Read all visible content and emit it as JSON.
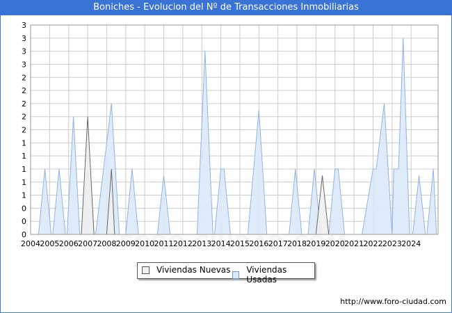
{
  "title": "Boniches - Evolucion del Nº de Transacciones Inmobiliarias",
  "source_url": "http://www.foro-ciudad.com",
  "watermark": "FORO-CIUDAD.COM",
  "colors": {
    "nuevas_fill": "#f0f0f0",
    "nuevas_stroke": "#666666",
    "usadas_fill": "#dce9f8",
    "usadas_stroke": "#8fb4e3",
    "title_bg": "#3a73d6",
    "grid": "#cccccc"
  },
  "chart_data": {
    "type": "area",
    "title": "Boniches - Evolucion del Nº de Transacciones Inmobiliarias",
    "x_ticks": [
      "2004",
      "2005",
      "2006",
      "2007",
      "2008",
      "2009",
      "2010",
      "2011",
      "2012",
      "2013",
      "2014",
      "2015",
      "2016",
      "2017",
      "2018",
      "2019",
      "2020",
      "2021",
      "2022",
      "2023",
      "2024"
    ],
    "y_tick_labels": [
      "0",
      "0",
      "0",
      "1",
      "1",
      "1",
      "1",
      "1",
      "2",
      "2",
      "2",
      "2",
      "2",
      "3",
      "3",
      "3",
      "3"
    ],
    "ylim": [
      0,
      3.2
    ],
    "grid": true,
    "legend_position": "bottom",
    "series": [
      {
        "name": "Viviendas Nuevas",
        "points": [
          [
            "2006-09",
            0
          ],
          [
            "2007-01",
            1.8
          ],
          [
            "2007-05",
            0
          ],
          [
            "2008-01",
            0
          ],
          [
            "2008-04",
            1
          ],
          [
            "2008-06",
            0
          ],
          [
            "2019-01",
            0
          ],
          [
            "2019-05",
            0.9
          ],
          [
            "2019-09",
            0
          ]
        ]
      },
      {
        "name": "Viviendas Usadas",
        "points": [
          [
            "2004-06",
            0
          ],
          [
            "2004-10",
            1
          ],
          [
            "2005-02",
            0
          ],
          [
            "2005-03",
            0
          ],
          [
            "2005-07",
            1
          ],
          [
            "2005-11",
            0
          ],
          [
            "2005-12",
            0
          ],
          [
            "2006-04",
            1.8
          ],
          [
            "2006-08",
            0
          ],
          [
            "2006-09",
            0
          ],
          [
            "2007-01",
            1
          ],
          [
            "2007-05",
            0
          ],
          [
            "2007-06",
            0
          ],
          [
            "2007-11",
            1
          ],
          [
            "2008-04",
            2
          ],
          [
            "2008-09",
            0
          ],
          [
            "2009-01",
            0
          ],
          [
            "2009-05",
            1
          ],
          [
            "2009-09",
            0
          ],
          [
            "2010-09",
            0
          ],
          [
            "2011-01",
            0.9
          ],
          [
            "2011-05",
            0
          ],
          [
            "2012-10",
            0
          ],
          [
            "2013-03",
            2.8
          ],
          [
            "2013-08",
            0
          ],
          [
            "2013-09",
            0
          ],
          [
            "2014-01",
            1
          ],
          [
            "2014-03",
            1
          ],
          [
            "2014-07",
            0
          ],
          [
            "2015-06",
            0
          ],
          [
            "2016-01",
            1.9
          ],
          [
            "2016-06",
            0
          ],
          [
            "2017-08",
            0
          ],
          [
            "2017-12",
            1
          ],
          [
            "2018-04",
            0
          ],
          [
            "2018-08",
            0
          ],
          [
            "2018-12",
            1
          ],
          [
            "2019-04",
            0
          ],
          [
            "2019-09",
            0
          ],
          [
            "2020-01",
            1
          ],
          [
            "2020-03",
            1
          ],
          [
            "2020-07",
            0
          ],
          [
            "2021-06",
            0
          ],
          [
            "2022-01",
            1
          ],
          [
            "2022-03",
            1
          ],
          [
            "2022-08",
            2
          ],
          [
            "2023-01",
            0
          ],
          [
            "2023-02",
            1
          ],
          [
            "2023-05",
            1
          ],
          [
            "2023-08",
            3
          ],
          [
            "2023-12",
            0
          ],
          [
            "2024-02",
            0
          ],
          [
            "2024-06",
            0.9
          ],
          [
            "2024-10",
            0
          ],
          [
            "2024-11",
            0
          ],
          [
            "2025-03",
            1
          ],
          [
            "2025-05",
            0
          ]
        ]
      }
    ]
  },
  "legend": {
    "nuevas_label": "Viviendas Nuevas",
    "usadas_label": "Viviendas Usadas"
  }
}
